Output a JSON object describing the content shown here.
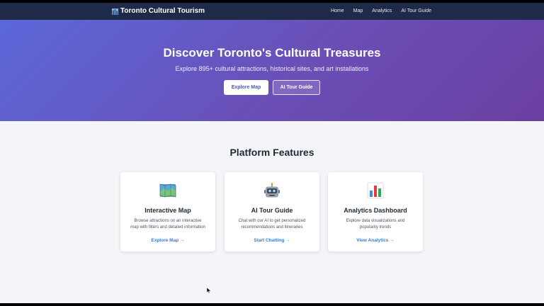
{
  "navbar": {
    "brand": "Toronto Cultural Tourism",
    "brand_icon": "city-icon",
    "links": [
      "Home",
      "Map",
      "Analytics",
      "AI Tour Guide"
    ]
  },
  "hero": {
    "title": "Discover Toronto's Cultural Treasures",
    "subtitle": "Explore 895+ cultural attractions, historical sites, and art installations",
    "primary_button": "Explore Map",
    "secondary_button": "AI Tour Guide"
  },
  "features": {
    "title": "Platform Features",
    "cards": [
      {
        "icon": "map-icon",
        "title": "Interactive Map",
        "desc_line1": "Browse attractions on an interactive",
        "desc_line2": "map with filters and detailed information",
        "link": "Explore Map →"
      },
      {
        "icon": "robot-icon",
        "title": "AI Tour Guide",
        "desc_line1": "Chat with our AI to get personalized",
        "desc_line2": "recommendations and itineraries",
        "link": "Start Chatting →"
      },
      {
        "icon": "bar-chart-icon",
        "title": "Analytics Dashboard",
        "desc_line1": "Explore data visualizations and",
        "desc_line2": "popularity trends",
        "link": "View Analytics →"
      }
    ]
  },
  "colors": {
    "navbar": "#1e2a47",
    "hero_start": "#5b68d9",
    "hero_end": "#6b3fa2",
    "link": "#3b7bd4"
  }
}
